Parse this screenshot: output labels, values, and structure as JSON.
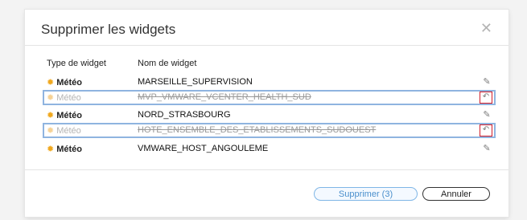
{
  "dialog": {
    "title": "Supprimer les widgets",
    "close_glyph": "✕",
    "columns": {
      "type": "Type de widget",
      "name": "Nom de widget"
    },
    "rows": [
      {
        "type": "Météo",
        "name": "MARSEILLE_SUPERVISION",
        "state": "active",
        "action_icon": "delete-icon",
        "action_glyph": "✎"
      },
      {
        "type": "Météo",
        "name": "MVP_VMWARE_VCENTER_HEALTH_SUD",
        "state": "to-delete",
        "action_icon": "undo-icon",
        "action_glyph": "↶"
      },
      {
        "type": "Météo",
        "name": "NORD_STRASBOURG",
        "state": "active",
        "action_icon": "delete-icon",
        "action_glyph": "✎"
      },
      {
        "type": "Météo",
        "name": "HOTE_ENSEMBLE_DES_ETABLISSEMENTS_SUDOUEST",
        "state": "to-delete",
        "action_icon": "undo-icon",
        "action_glyph": "↶"
      },
      {
        "type": "Météo",
        "name": "VMWARE_HOST_ANGOULEME",
        "state": "active",
        "action_icon": "delete-icon",
        "action_glyph": "✎"
      }
    ],
    "buttons": {
      "primary": "Supprimer (3)",
      "cancel": "Annuler"
    }
  },
  "icons": {
    "weather": "sun-icon",
    "sun_glyph": "✹"
  },
  "colors": {
    "accent": "#4a8fcc",
    "highlight_border": "#8fb4e0",
    "undo_border": "#d11e2a",
    "sun": "#f0a81e"
  }
}
